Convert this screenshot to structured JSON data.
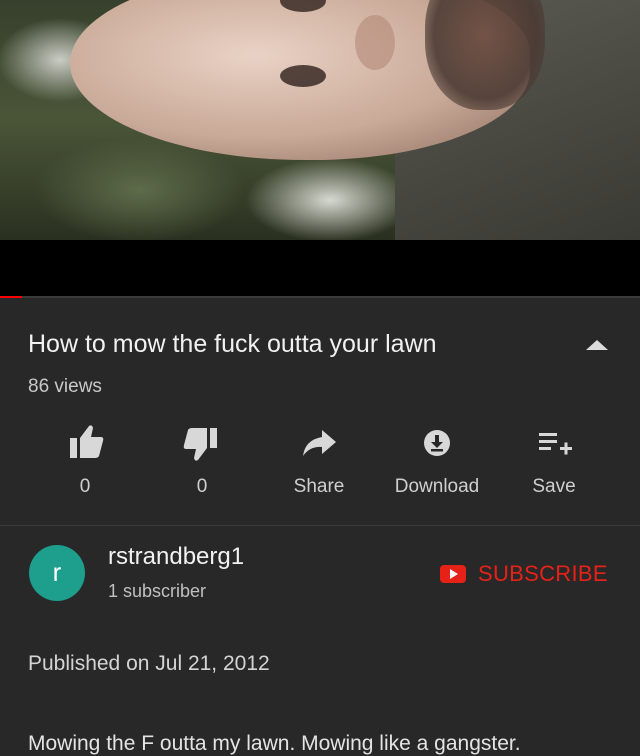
{
  "video": {
    "progress_fraction": 0.035
  },
  "info": {
    "title": "How to mow the fuck outta your lawn",
    "views": "86 views"
  },
  "actions": {
    "like_count": "0",
    "dislike_count": "0",
    "share_label": "Share",
    "download_label": "Download",
    "save_label": "Save"
  },
  "channel": {
    "avatar_letter": "r",
    "avatar_color": "#1e9e8c",
    "name": "rstrandberg1",
    "subscribers": "1 subscriber",
    "subscribe_label": "SUBSCRIBE",
    "subscribe_color": "#e62117"
  },
  "meta": {
    "published": "Published on Jul 21, 2012",
    "description": "Mowing the F outta my lawn. Mowing like a gangster."
  },
  "icons": [
    "thumbs-up-icon",
    "thumbs-down-icon",
    "share-arrow-icon",
    "download-icon",
    "save-to-playlist-icon",
    "collapse-chevron-icon",
    "subscribe-logo-icon"
  ]
}
